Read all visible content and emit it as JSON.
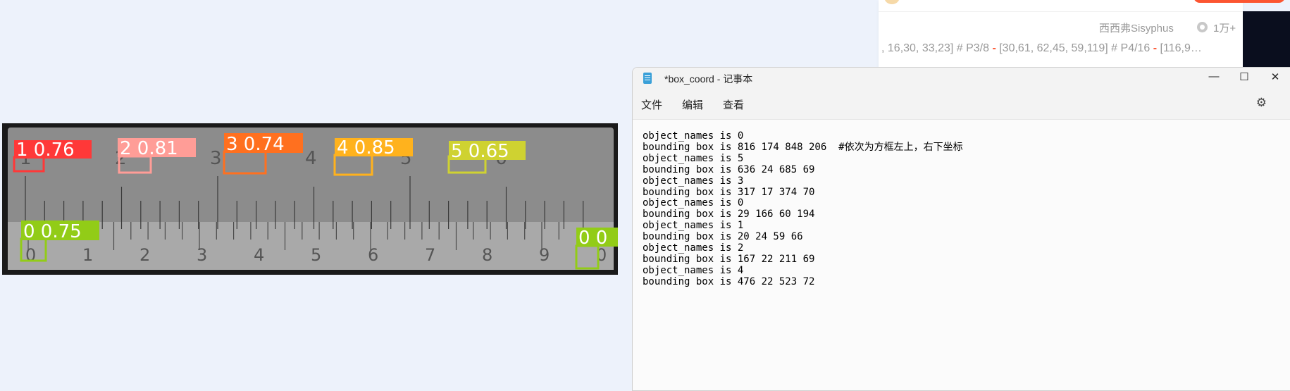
{
  "detection_image": {
    "detections": [
      {
        "label": "1 0.76",
        "color": "#ff3838"
      },
      {
        "label": "2 0.81",
        "color": "#ff9d97"
      },
      {
        "label": "3 0.74",
        "color": "#ff701f"
      },
      {
        "label": "4 0.85",
        "color": "#ffb21d"
      },
      {
        "label": "5 0.65",
        "color": "#cfd231"
      },
      {
        "label": "0 0.75",
        "color": "#92cc17"
      },
      {
        "label": "0 0",
        "color": "#92cc17"
      }
    ],
    "top_scale": [
      "1",
      "2",
      "3",
      "4",
      "5",
      "6"
    ],
    "bottom_scale": [
      "0",
      "1",
      "2",
      "3",
      "4",
      "5",
      "6",
      "7",
      "8",
      "9",
      "0"
    ]
  },
  "browser": {
    "author": "西西弗Sisyphus",
    "views": "1万+",
    "snippet_parts": [
      ", 16,30, 33,23] # P3/8 ",
      "-",
      " [30,61, 62,45, 59,119] # P4/16 ",
      "-",
      " [116,9…"
    ]
  },
  "notepad": {
    "title": "*box_coord - 记事本",
    "menu": [
      "文件",
      "编辑",
      "查看"
    ],
    "lines": [
      "object_names is 0",
      "bounding box is 816 174 848 206  #依次为方框左上，右下坐标",
      "object_names is 5",
      "bounding box is 636 24 685 69",
      "object_names is 3",
      "bounding box is 317 17 374 70",
      "object_names is 0",
      "bounding box is 29 166 60 194",
      "object_names is 1",
      "bounding box is 20 24 59 66",
      "object_names is 2",
      "bounding box is 167 22 211 69",
      "object_names is 4",
      "bounding box is 476 22 523 72"
    ]
  }
}
